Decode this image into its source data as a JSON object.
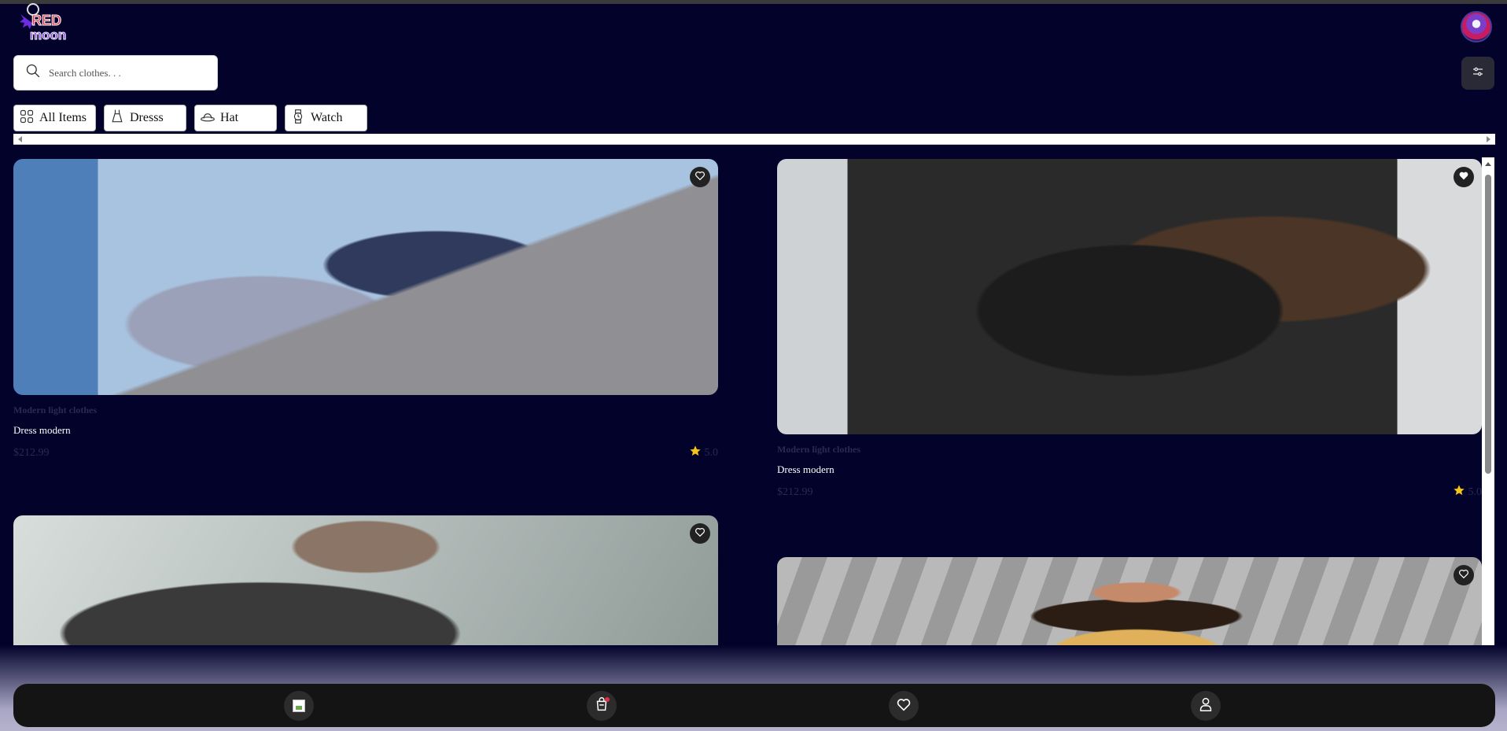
{
  "brand": {
    "logo_line1": "RED",
    "logo_line2": "moon"
  },
  "search": {
    "placeholder": "Search clothes. . ."
  },
  "categories": [
    {
      "label": "All Items",
      "icon": "grid-icon"
    },
    {
      "label": "Dresss",
      "icon": "dress-icon"
    },
    {
      "label": "Hat",
      "icon": "hat-icon"
    },
    {
      "label": "Watch",
      "icon": "watch-icon"
    }
  ],
  "products": [
    {
      "brand": "Modern light clothes",
      "name": "Dress modern",
      "price": "$212.99",
      "rating": "5.0",
      "favorited": false
    },
    {
      "brand": "Modern light clothes",
      "name": "Dress modern",
      "price": "$212.99",
      "rating": "5.0",
      "favorited": true
    },
    {
      "brand": "",
      "name": "",
      "price": "",
      "rating": "",
      "favorited": false
    },
    {
      "brand": "",
      "name": "",
      "price": "",
      "rating": "",
      "favorited": false
    }
  ],
  "nav": [
    {
      "name": "home",
      "icon": "broken-image-icon"
    },
    {
      "name": "cart",
      "icon": "shopping-bag-icon",
      "badge": true
    },
    {
      "name": "favorites",
      "icon": "heart-icon"
    },
    {
      "name": "profile",
      "icon": "user-icon"
    }
  ],
  "colors": {
    "background": "#02022b",
    "accent": "#e0304a",
    "star": "#f5c518"
  }
}
